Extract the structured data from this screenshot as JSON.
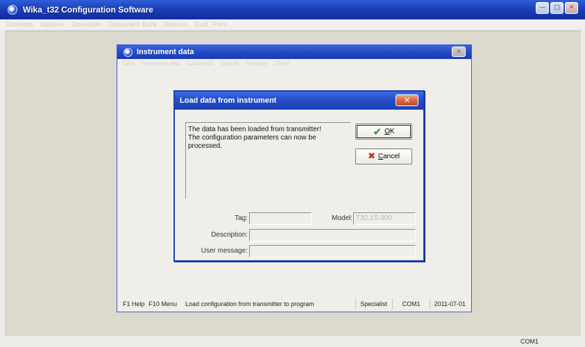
{
  "app": {
    "title": "Wika_t32 Configuration Software",
    "menu": [
      "Contents",
      "Options",
      "Operation",
      "Document Data",
      "Options",
      "Cust. Pers."
    ],
    "window_controls": {
      "minimize": "—",
      "maximize": "□",
      "close": "✕"
    }
  },
  "child_window": {
    "title": "Instrument data",
    "close_glyph": "✕",
    "menu": [
      "Data",
      "Instrument data",
      "Calibration",
      "Special",
      "Simulate",
      "Check"
    ],
    "status": {
      "help": "F1 Help",
      "menu": "F10 Menu",
      "message": "Load configuration from transmitter to program",
      "user_level": "Specialist",
      "port": "COM1",
      "date": "2011-07-01"
    }
  },
  "dialog": {
    "title": "Load data from instrument",
    "close_glyph": "✕",
    "message_lines": [
      "The data has been loaded from transmitter!",
      "The configuration parameters can now be",
      "processed."
    ],
    "ok": {
      "icon": "check-icon",
      "mnemonic": "O",
      "rest": "K"
    },
    "cancel": {
      "icon": "x-icon",
      "mnemonic": "C",
      "rest": "ancel"
    },
    "fields": {
      "tag_label": "Tag:",
      "tag_value": "",
      "model_label": "Model:",
      "model_value": "T32.1S.000",
      "description_label": "Description:",
      "description_value": "",
      "user_message_label": "User message:",
      "user_message_value": ""
    }
  },
  "main_status": {
    "port": "COM1"
  }
}
